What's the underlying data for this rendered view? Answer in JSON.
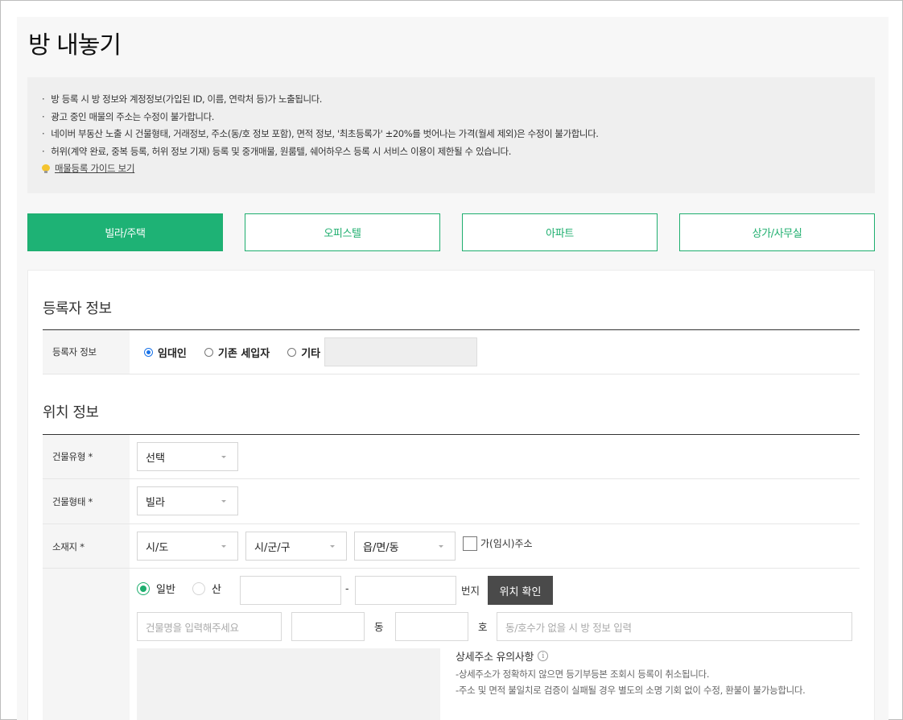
{
  "page": {
    "title": "방 내놓기"
  },
  "notice": {
    "items": [
      "방 등록 시 방 정보와 계정정보(가입된 ID, 이름, 연락처 등)가 노출됩니다.",
      "광고 중인 매물의 주소는 수정이 불가합니다.",
      "네이버 부동산 노출 시 건물형태, 거래정보, 주소(동/호 정보 포함), 면적 정보, '최초등록가' ±20%를 벗어나는 가격(월세 제외)은 수정이 불가합니다.",
      "허위(계약 완료, 중복 등록, 허위 정보 기재) 등록 및 중개매물, 원룸텔, 쉐어하우스 등록 시 서비스 이용이 제한될 수 있습니다."
    ],
    "guide_link": "매물등록 가이드 보기",
    "guide_icon": "lightbulb-icon"
  },
  "tabs": [
    {
      "label": "빌라/주택",
      "active": true
    },
    {
      "label": "오피스텔",
      "active": false
    },
    {
      "label": "아파트",
      "active": false
    },
    {
      "label": "상가/사무실",
      "active": false
    }
  ],
  "registrant": {
    "section_title": "등록자 정보",
    "row_label": "등록자 정보",
    "options": [
      {
        "label": "임대인",
        "checked": true
      },
      {
        "label": "기존 세입자",
        "checked": false
      },
      {
        "label": "기타",
        "checked": false
      }
    ]
  },
  "location": {
    "section_title": "위치 정보",
    "building_type_label": "건물유형 *",
    "building_type_value": "선택",
    "building_form_label": "건물형태 *",
    "building_form_value": "빌라",
    "address_label": "소재지 *",
    "sido": "시/도",
    "sigungu": "시/군/구",
    "eupmyeondong": "읍/면/동",
    "temp_address_label": "가(임시)주소",
    "lot_general": "일반",
    "lot_mountain": "산",
    "dash": "-",
    "lot_suffix": "번지",
    "verify_button": "위치 확인",
    "building_name_placeholder": "건물명을 입력해주세요",
    "dong_label": "동",
    "ho_label": "호",
    "dongho_placeholder": "동/호수가 없을 시 방 정보 입력",
    "caution_title": "상세주소 유의사항",
    "caution_lines": [
      "-상세주소가 정확하지 않으면 등기부등본 조회시 등록이 취소됩니다.",
      "-주소 및 면적 불일치로 검증이 실패될 경우 별도의 소명 기회 없이 수정, 환불이 불가능합니다."
    ]
  },
  "colors": {
    "accent_green": "#1eb275",
    "radio_blue": "#1a73e8",
    "dark_button": "#4a4a4a"
  }
}
